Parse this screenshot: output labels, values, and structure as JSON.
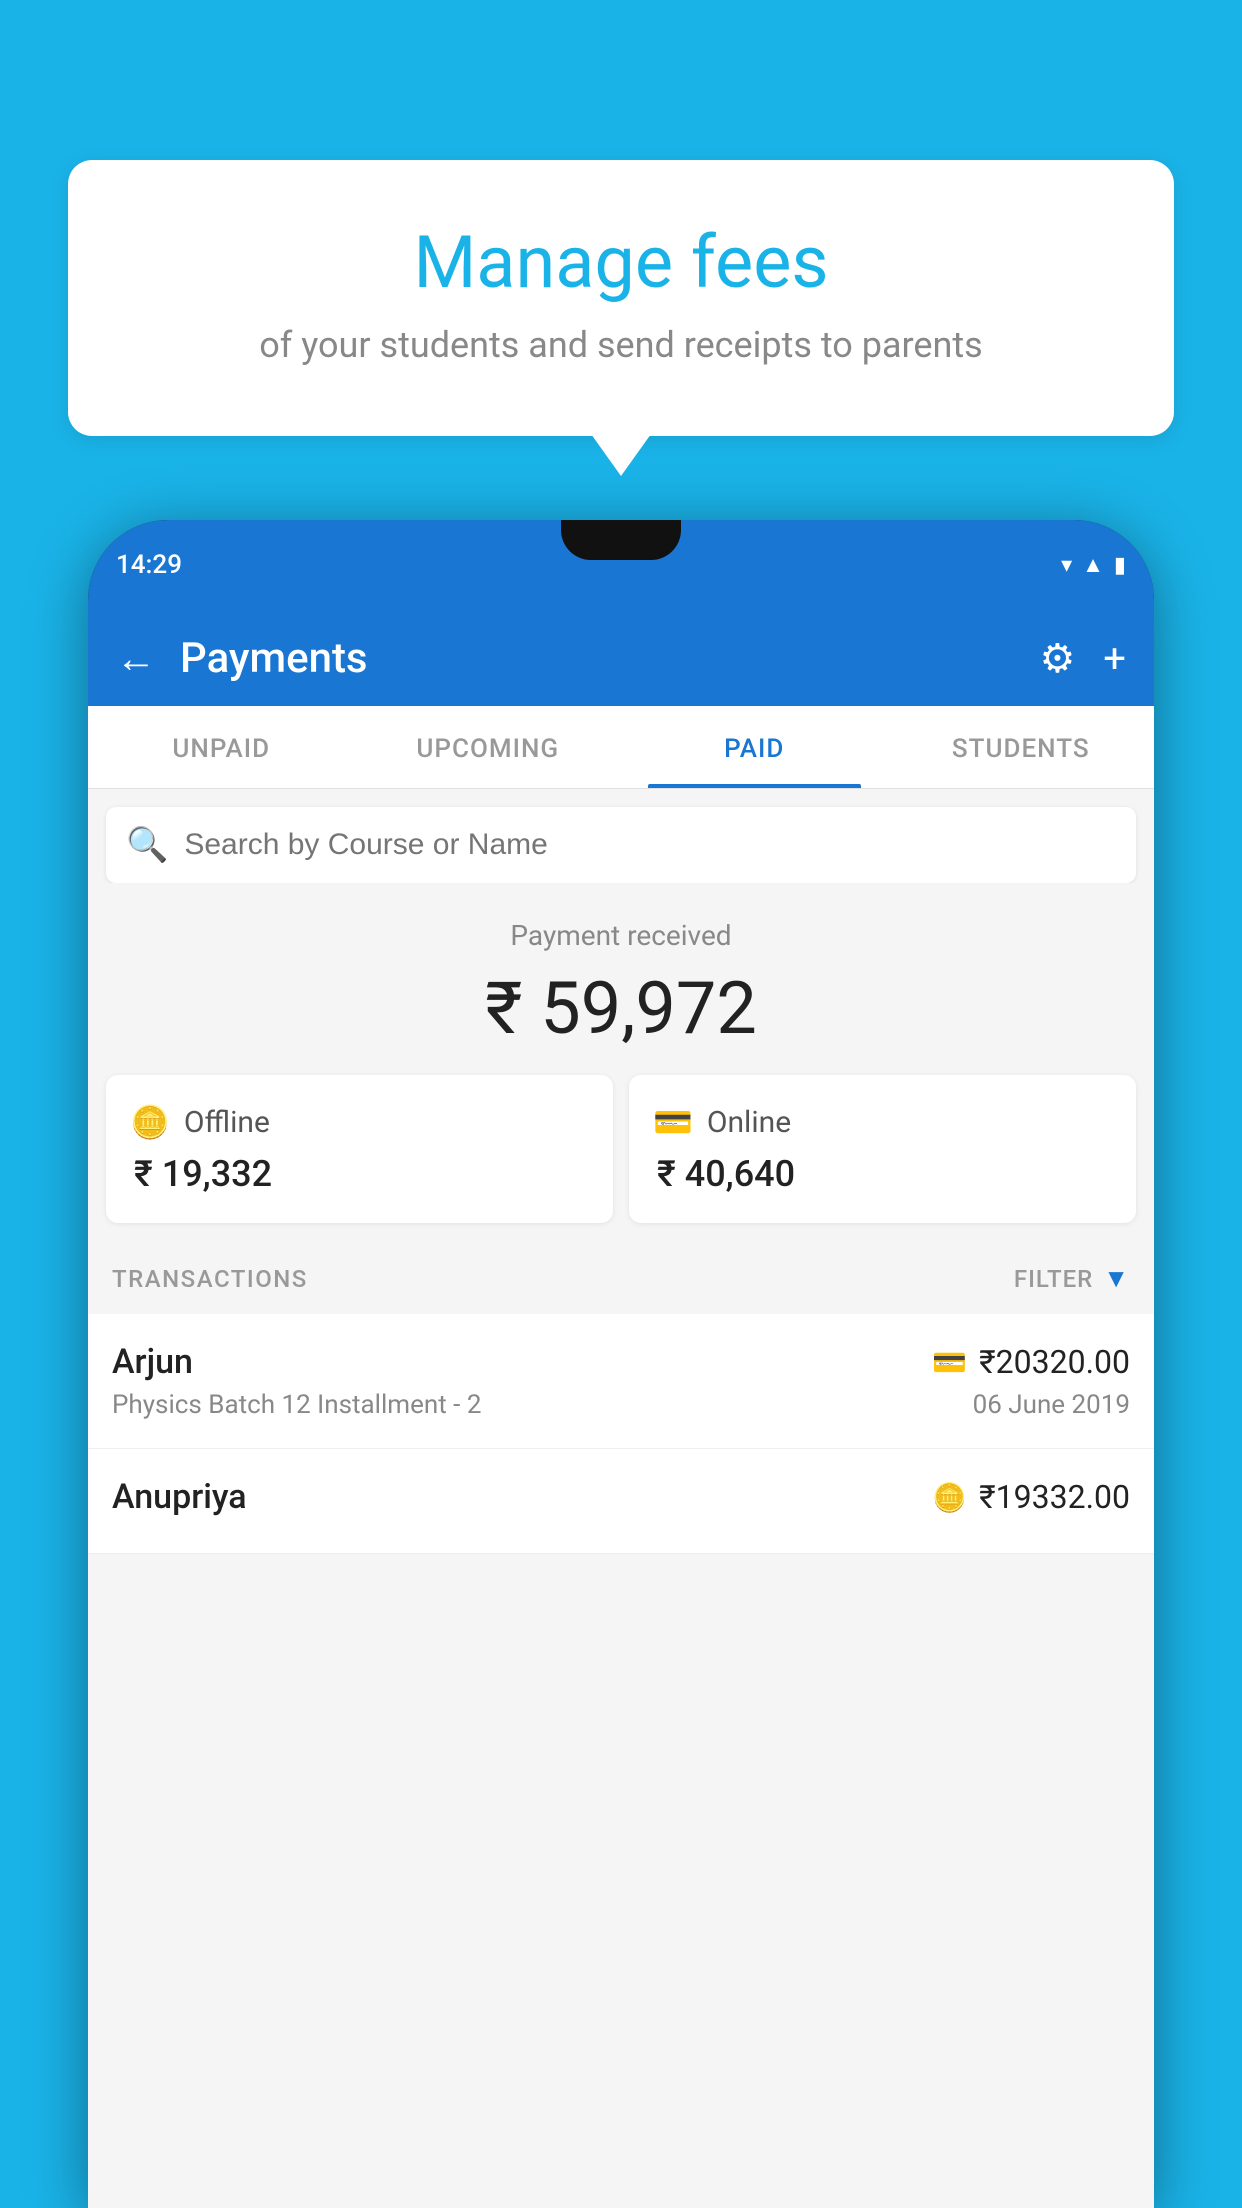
{
  "background_color": "#1ab3e8",
  "bubble": {
    "title": "Manage fees",
    "subtitle": "of your students and send receipts to parents"
  },
  "status_bar": {
    "time": "14:29",
    "wifi_icon": "▼",
    "signal_icon": "▲",
    "battery_icon": "▮"
  },
  "header": {
    "title": "Payments",
    "back_label": "←",
    "settings_icon": "⚙",
    "add_icon": "+"
  },
  "tabs": [
    {
      "label": "UNPAID",
      "active": false
    },
    {
      "label": "UPCOMING",
      "active": false
    },
    {
      "label": "PAID",
      "active": true
    },
    {
      "label": "STUDENTS",
      "active": false
    }
  ],
  "search": {
    "placeholder": "Search by Course or Name"
  },
  "payment_summary": {
    "label": "Payment received",
    "amount": "₹ 59,972",
    "offline": {
      "type": "Offline",
      "amount": "₹ 19,332"
    },
    "online": {
      "type": "Online",
      "amount": "₹ 40,640"
    }
  },
  "transactions": {
    "label": "TRANSACTIONS",
    "filter_label": "FILTER"
  },
  "transaction_list": [
    {
      "name": "Arjun",
      "course": "Physics Batch 12 Installment - 2",
      "amount": "₹20320.00",
      "date": "06 June 2019",
      "payment_type": "online"
    },
    {
      "name": "Anupriya",
      "course": "",
      "amount": "₹19332.00",
      "date": "",
      "payment_type": "offline"
    }
  ]
}
